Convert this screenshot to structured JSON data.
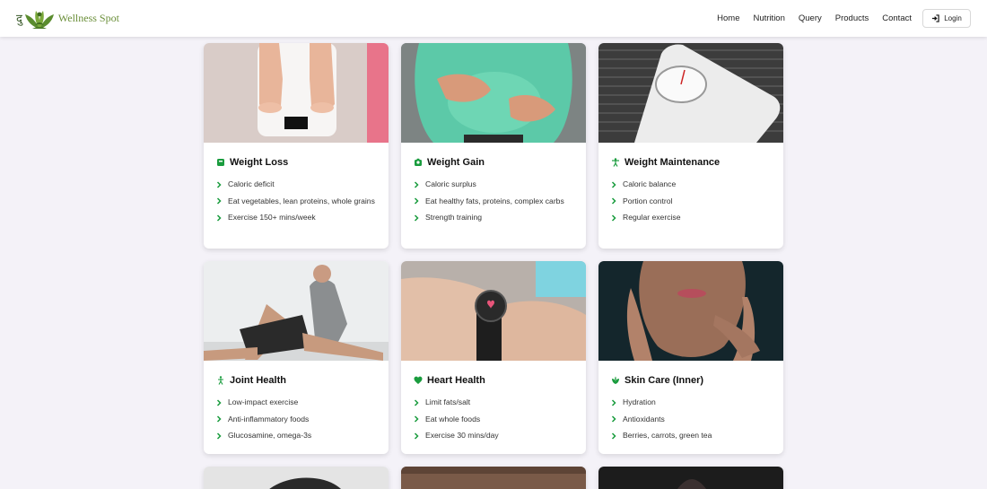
{
  "brand": {
    "glyph": "दु",
    "name": "Wellness Spot"
  },
  "nav": {
    "links": [
      "Home",
      "Nutrition",
      "Query",
      "Products",
      "Contact"
    ],
    "login_label": "Login"
  },
  "colors": {
    "accent": "#1a9c3e",
    "brand": "#6b8f3a",
    "background": "#f4f2f8"
  },
  "cards": [
    {
      "title": "Weight Loss",
      "icon": "scale-icon",
      "image": "feet-on-scale-photo",
      "items": [
        "Caloric deficit",
        "Eat vegetables, lean proteins, whole grains",
        "Exercise 150+ mins/week"
      ]
    },
    {
      "title": "Weight Gain",
      "icon": "weight-icon",
      "image": "belly-photo",
      "items": [
        "Caloric surplus",
        "Eat healthy fats, proteins, complex carbs",
        "Strength training"
      ]
    },
    {
      "title": "Weight Maintenance",
      "icon": "balance-person-icon",
      "image": "analog-scale-photo",
      "items": [
        "Caloric balance",
        "Portion control",
        "Regular exercise"
      ]
    },
    {
      "title": "Joint Health",
      "icon": "person-icon",
      "image": "knee-physio-photo",
      "items": [
        "Low-impact exercise",
        "Anti-inflammatory foods",
        "Glucosamine, omega-3s"
      ]
    },
    {
      "title": "Heart Health",
      "icon": "heart-icon",
      "image": "smartwatch-photo",
      "items": [
        "Limit fats/salt",
        "Eat whole foods",
        "Exercise 30 mins/day"
      ]
    },
    {
      "title": "Skin Care (Inner)",
      "icon": "spa-icon",
      "image": "face-skin-photo",
      "items": [
        "Hydration",
        "Antioxidants",
        "Berries, carrots, green tea"
      ]
    },
    {
      "title": "",
      "icon": "",
      "image": "partial-photo-1",
      "items": []
    },
    {
      "title": "",
      "icon": "",
      "image": "partial-photo-2",
      "items": []
    },
    {
      "title": "",
      "icon": "",
      "image": "partial-photo-3",
      "items": []
    }
  ]
}
